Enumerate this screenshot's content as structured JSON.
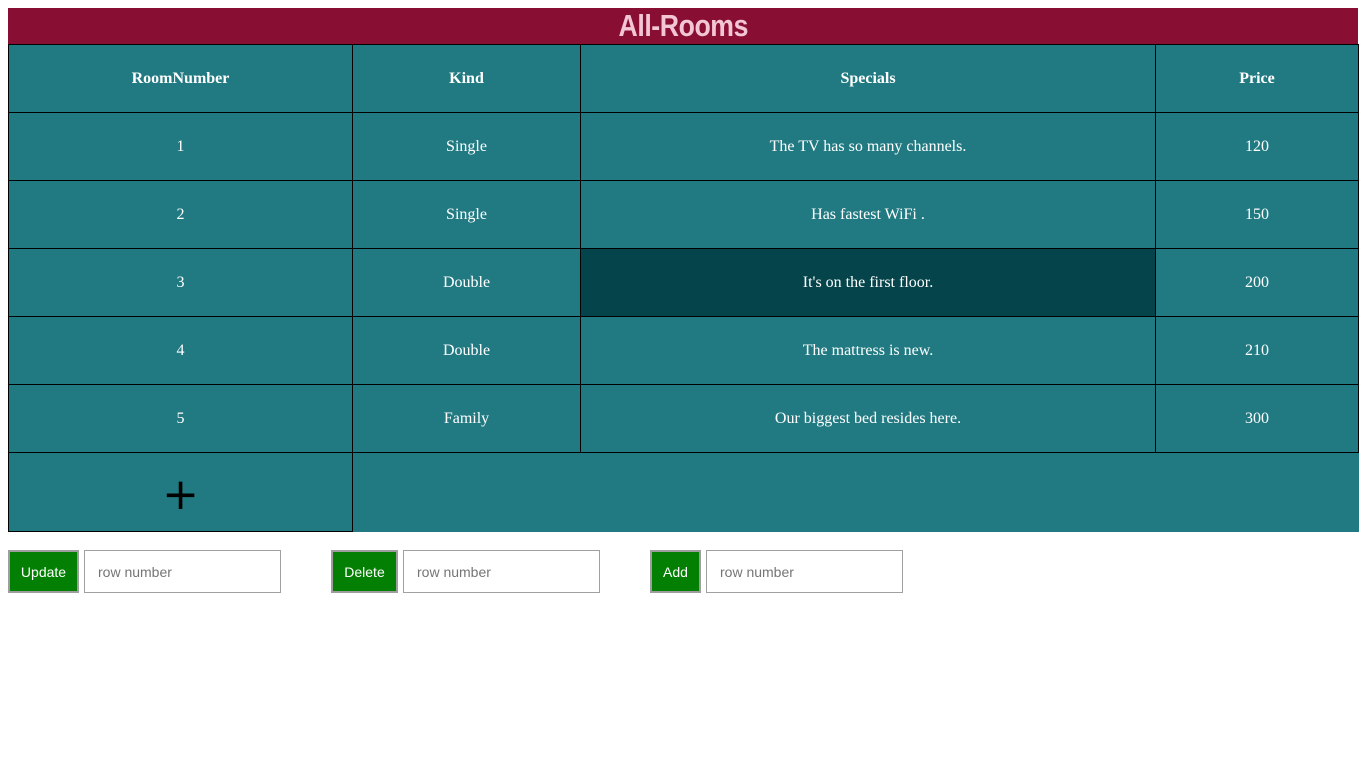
{
  "title": "All-Rooms",
  "table": {
    "headers": [
      "RoomNumber",
      "Kind",
      "Specials",
      "Price"
    ],
    "rows": [
      [
        "1",
        "Single",
        "The TV has so many channels.",
        "120"
      ],
      [
        "2",
        "Single",
        "Has fastest WiFi .",
        "150"
      ],
      [
        "3",
        "Double",
        "It's on the first floor.",
        "200"
      ],
      [
        "4",
        "Double",
        "The mattress is new.",
        "210"
      ],
      [
        "5",
        "Family",
        "Our biggest bed resides here.",
        "300"
      ]
    ],
    "add_icon": "+"
  },
  "controls": {
    "update_label": "Update",
    "update_placeholder": "row number",
    "delete_label": "Delete",
    "delete_placeholder": "row number",
    "add_label": "Add",
    "add_placeholder": "row number"
  },
  "colors": {
    "title_background": "#880e33",
    "title_text": "#f3c6d6",
    "table_background": "#217a82",
    "highlighted_cell": "#05444b",
    "button_background": "#038003"
  }
}
